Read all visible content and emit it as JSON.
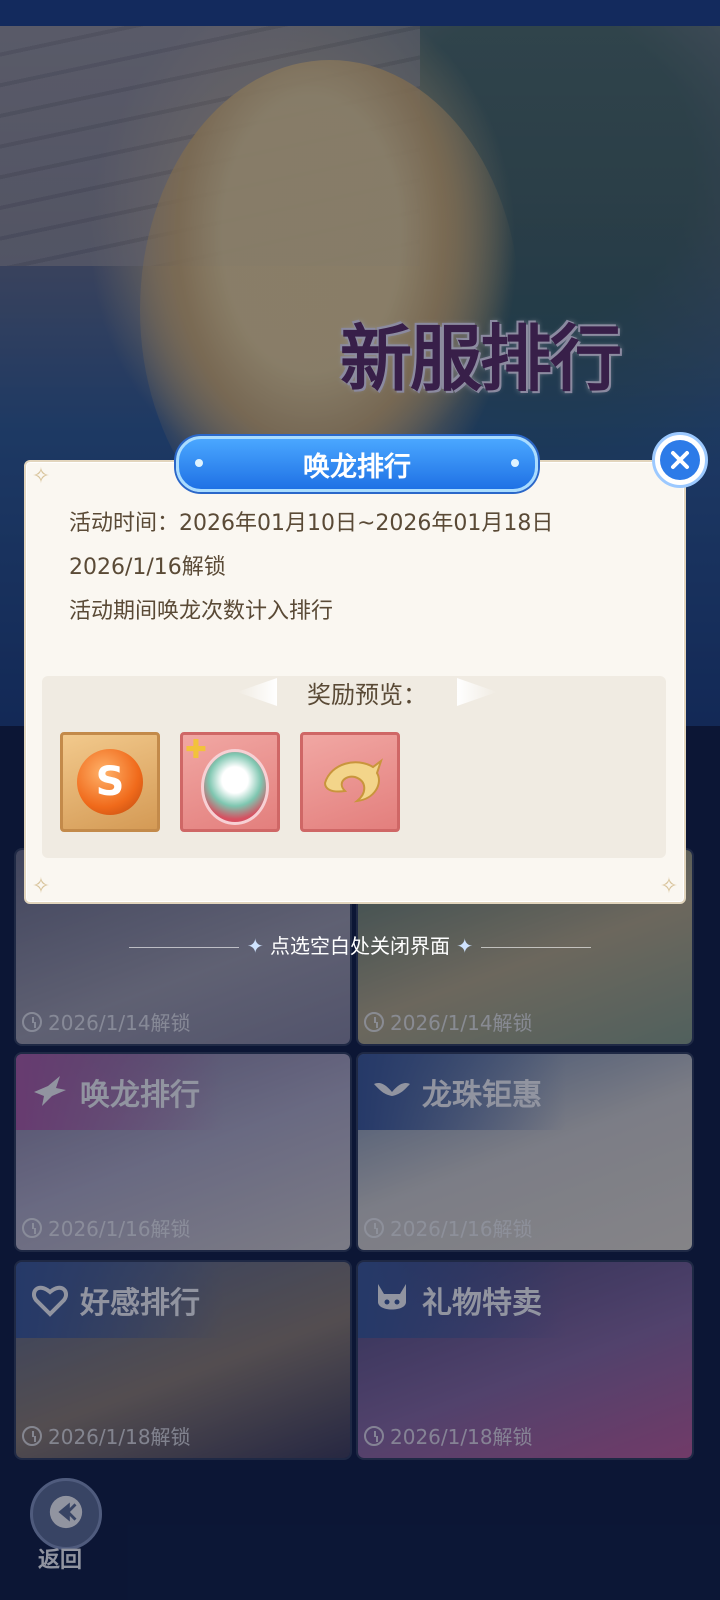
{
  "banner": {
    "title": "新服排行"
  },
  "cards": [
    {
      "name": "",
      "unlock": "2026/1/14解锁"
    },
    {
      "name": "",
      "unlock": "2026/1/14解锁"
    },
    {
      "name": "唤龙排行",
      "unlock": "2026/1/16解锁"
    },
    {
      "name": "龙珠钜惠",
      "unlock": "2026/1/16解锁"
    },
    {
      "name": "好感排行",
      "unlock": "2026/1/18解锁"
    },
    {
      "name": "礼物特卖",
      "unlock": "2026/1/18解锁"
    }
  ],
  "dialog": {
    "title": "唤龙排行",
    "activity_time": "活动时间：2026年01月10日~2026年01月18日",
    "unlock_date": "2026/1/16解锁",
    "description": "活动期间唤龙次数计入排行",
    "reward_title": "奖励预览：",
    "rewards": [
      {
        "icon": "dragon-orb-icon",
        "frame": "gold"
      },
      {
        "icon": "character-puzzle-icon",
        "frame": "pink"
      },
      {
        "icon": "golden-dragon-icon",
        "frame": "pink"
      }
    ]
  },
  "hint": "点选空白处关闭界面",
  "back_label": "返回",
  "colors": {
    "title_blue": "#2d7be8",
    "dialog_bg": "#faf7f1",
    "text_brown": "#5a4a36"
  }
}
